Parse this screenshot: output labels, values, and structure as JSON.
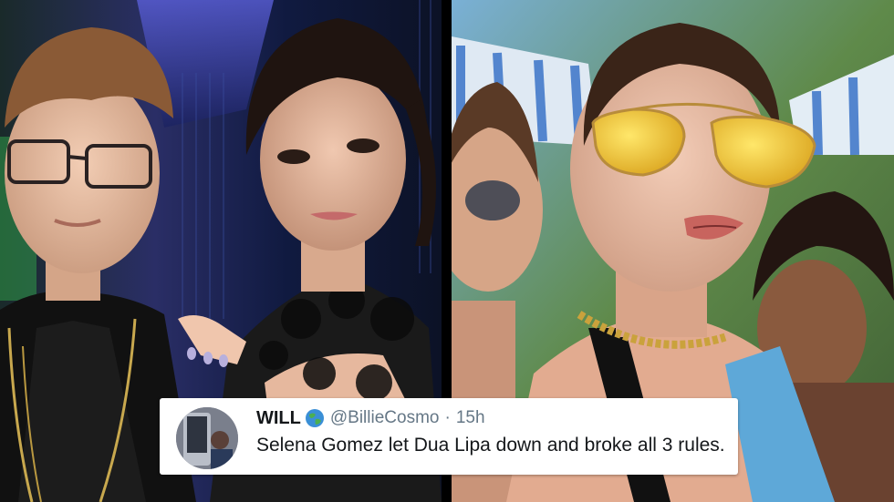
{
  "tweet": {
    "display_name": "WILL",
    "handle": "@BillieCosmo",
    "separator": "·",
    "time": "15h",
    "text": "Selena Gomez let Dua Lipa down and broke all 3 rules.",
    "badge_icon": "globe-icon",
    "avatar_icon": "avatar-photo"
  },
  "colors": {
    "name": "#14171a",
    "meta": "#657786",
    "card_bg": "#ffffff"
  }
}
